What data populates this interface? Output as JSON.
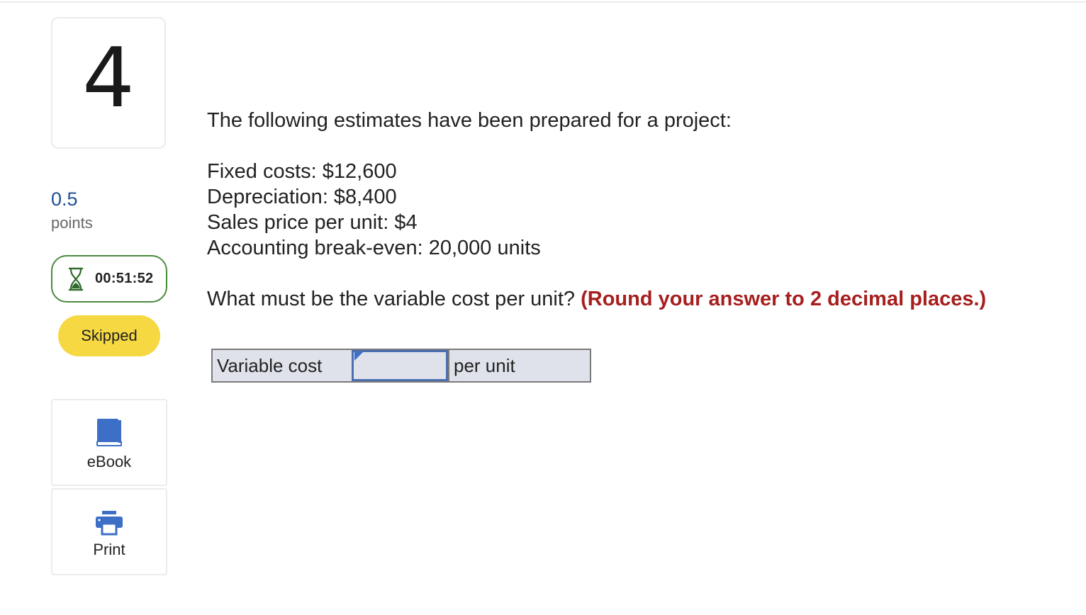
{
  "question": {
    "number": "4",
    "points_value": "0.5",
    "points_label": "points",
    "timer": "00:51:52",
    "status": "Skipped",
    "intro": "The following estimates have been prepared for a project:",
    "facts": [
      "Fixed costs: $12,600",
      "Depreciation: $8,400",
      "Sales price per unit: $4",
      "Accounting break-even: 20,000 units"
    ],
    "prompt": "What must be the variable cost per unit?",
    "hint": "(Round your answer to 2 decimal places.)"
  },
  "answer": {
    "left_label": "Variable cost",
    "input_value": "",
    "right_label": "per unit"
  },
  "tools": {
    "ebook_label": "eBook",
    "print_label": "Print"
  },
  "colors": {
    "points": "#1f4f96",
    "timer_border": "#4a8a3c",
    "status_pill": "#f6d842",
    "hint": "#a61f1f",
    "input_border": "#4a6fb0",
    "icon_blue": "#3d6fc7"
  },
  "icons": {
    "timer": "hourglass-icon",
    "ebook": "book-icon",
    "print": "printer-icon"
  }
}
